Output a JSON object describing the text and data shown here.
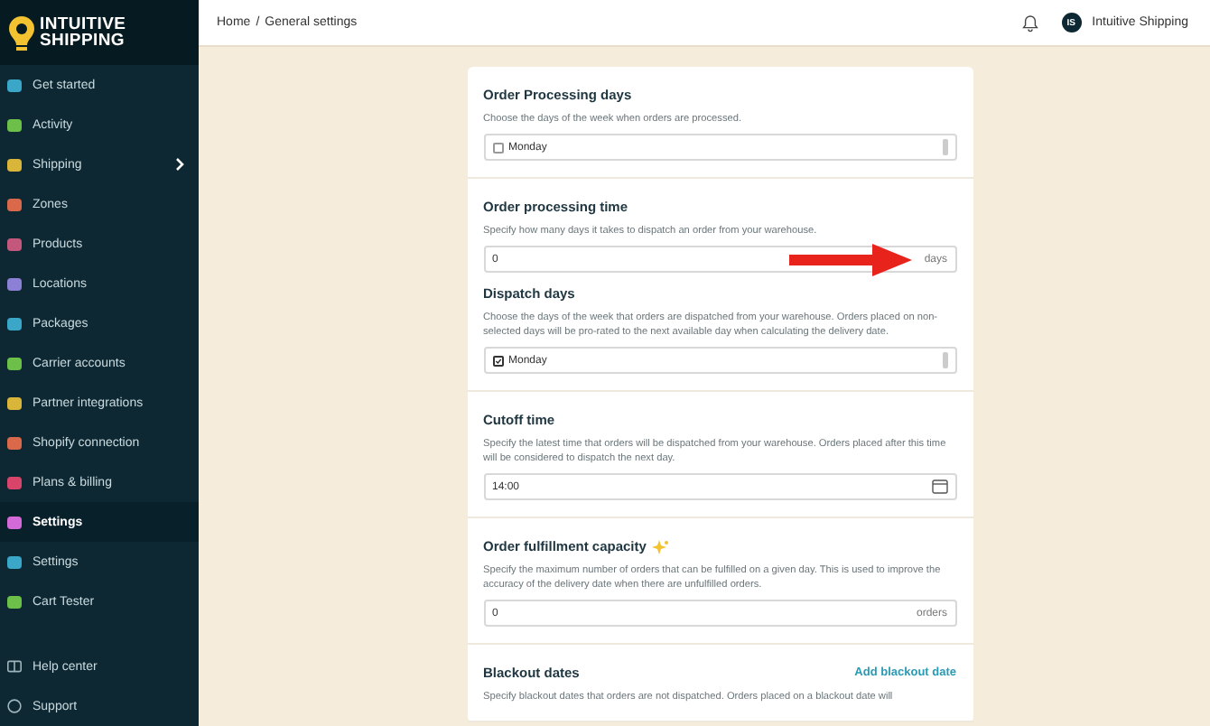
{
  "logo": {
    "lines": [
      "INTUITIVE",
      "SHIPPING"
    ]
  },
  "sidebar": {
    "items": [
      {
        "label": "Get started",
        "selected": false,
        "has_submenu": false,
        "color": "#3aa6c8"
      },
      {
        "label": "Activity",
        "selected": false,
        "has_submenu": false,
        "color": "#6cc04a"
      },
      {
        "label": "Shipping",
        "selected": false,
        "has_submenu": true,
        "color": "#d9b53a"
      },
      {
        "label": "Zones",
        "selected": false,
        "has_submenu": false,
        "color": "#d9694a"
      },
      {
        "label": "Products",
        "selected": false,
        "has_submenu": false,
        "color": "#c4577c"
      },
      {
        "label": "Locations",
        "selected": false,
        "has_submenu": false,
        "color": "#8c7fd6"
      },
      {
        "label": "Packages",
        "selected": false,
        "has_submenu": false,
        "color": "#3aa6c8"
      },
      {
        "label": "Carrier accounts",
        "selected": false,
        "has_submenu": false,
        "color": "#6cc04a"
      },
      {
        "label": "Partner integrations",
        "selected": false,
        "has_submenu": false,
        "color": "#d9b53a"
      },
      {
        "label": "Shopify connection",
        "selected": false,
        "has_submenu": false,
        "color": "#d9694a"
      },
      {
        "label": "Plans & billing",
        "selected": false,
        "has_submenu": false,
        "color": "#d9456a"
      },
      {
        "label": "Settings",
        "selected": true,
        "has_submenu": false,
        "color": "#d46ad8"
      },
      {
        "label": "Settings",
        "selected": false,
        "has_submenu": false,
        "color": "#3aa6c8"
      },
      {
        "label": "Cart Tester",
        "selected": false,
        "has_submenu": false,
        "color": "#6cc04a"
      }
    ],
    "footer_items": [
      {
        "label": "Help center"
      },
      {
        "label": "Support"
      }
    ]
  },
  "header": {
    "breadcrumb": [
      "Home",
      "General settings"
    ],
    "separator": "/",
    "user": {
      "initials": "IS",
      "name": "Intuitive Shipping"
    }
  },
  "sections": [
    {
      "groups": [
        {
          "kind": "multiselect",
          "title": "Order Processing days",
          "description": "Choose the days of the week when orders are processed.",
          "options": [
            {
              "label": "Monday",
              "checked": false
            }
          ]
        }
      ]
    },
    {
      "groups": [
        {
          "kind": "number",
          "title": "Order processing time",
          "description": "Specify how many days it takes to dispatch an order from your warehouse.",
          "value": "0",
          "unit": "days",
          "annotated": true
        },
        {
          "kind": "multiselect",
          "title": "Dispatch days",
          "description": "Choose the days of the week that orders are dispatched from your warehouse. Orders placed on non-selected days will be pro-rated to the next available day when calculating the delivery date.",
          "options": [
            {
              "label": "Monday",
              "checked": true
            }
          ]
        }
      ]
    },
    {
      "groups": [
        {
          "kind": "time",
          "title": "Cutoff time",
          "description": "Specify the latest time that orders will be dispatched from your warehouse. Orders placed after this time will be considered to dispatch the next day.",
          "value": "14:00"
        }
      ]
    },
    {
      "groups": [
        {
          "kind": "number",
          "title": "Order fulfillment capacity",
          "new_feature": true,
          "description": "Specify the maximum number of orders that can be fulfilled on a given day. This is used to improve the accuracy of the delivery date when there are unfulfilled orders.",
          "value": "0",
          "unit": "orders"
        }
      ]
    },
    {
      "groups": [
        {
          "kind": "action",
          "title": "Blackout dates",
          "action_label": "Add blackout date",
          "description": "Specify blackout dates that orders are not dispatched. Orders placed on a blackout date will"
        }
      ]
    }
  ]
}
